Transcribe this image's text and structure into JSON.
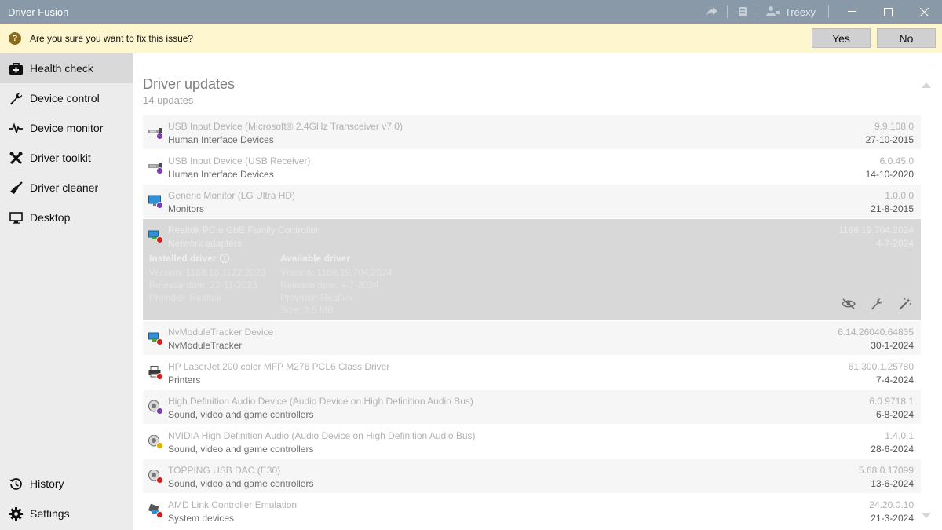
{
  "window": {
    "title": "Driver Fusion",
    "user_name": "Treexy"
  },
  "confirm": {
    "icon_glyph": "?",
    "message": "Are you sure you want to fix this issue?",
    "yes_label": "Yes",
    "no_label": "No"
  },
  "sidebar": {
    "items": [
      {
        "label": "Health check",
        "icon": "medkit-icon",
        "active": true
      },
      {
        "label": "Device control",
        "icon": "wrench-icon"
      },
      {
        "label": "Device monitor",
        "icon": "pulse-icon"
      },
      {
        "label": "Driver toolkit",
        "icon": "tools-icon"
      },
      {
        "label": "Driver cleaner",
        "icon": "broom-icon"
      },
      {
        "label": "Desktop",
        "icon": "monitor-icon"
      }
    ],
    "bottom": [
      {
        "label": "History",
        "icon": "history-icon"
      },
      {
        "label": "Settings",
        "icon": "gear-icon"
      }
    ]
  },
  "main": {
    "title": "Driver updates",
    "subtitle": "14 updates"
  },
  "devices": [
    {
      "name": "USB Input Device (Microsoft® 2.4GHz Transceiver v7.0)",
      "category": "Human Interface Devices",
      "version": "9.9.108.0",
      "date": "27-10-2015",
      "icon": "usb-icon",
      "dot": "#7b3fb0"
    },
    {
      "name": "USB Input Device (USB Receiver)",
      "category": "Human Interface Devices",
      "version": "6.0.45.0",
      "date": "14-10-2020",
      "icon": "usb-icon",
      "dot": "#7b3fb0"
    },
    {
      "name": "Generic Monitor (LG Ultra HD)",
      "category": "Monitors",
      "version": "1.0.0.0",
      "date": "21-8-2015",
      "icon": "monitor-icon",
      "dot": "#7b3fb0"
    },
    {
      "name": "Realtek PCIe GbE Family Controller",
      "category": "Network adapters",
      "version": "1168.19.704.2024",
      "date": "4-7-2024",
      "icon": "network-icon",
      "dot": "#d42020",
      "installed": {
        "heading": "Installed driver",
        "version": "Version: 1168.16.1122.2023",
        "release": "Release date: 22-11-2023",
        "provider": "Provider: Realtek"
      },
      "available": {
        "heading": "Available driver",
        "version": "Version: 1168.19.704.2024",
        "release": "Release date: 4-7-2024",
        "provider": "Provider: Realtek",
        "size": "Size: 2.5 MB"
      }
    },
    {
      "name": "NvModuleTracker Device",
      "category": "NvModuleTracker",
      "version": "6.14.26040.64835",
      "date": "30-1-2024",
      "icon": "network-icon",
      "dot": "#d42020"
    },
    {
      "name": "HP LaserJet 200 color MFP M276 PCL6 Class Driver",
      "category": "Printers",
      "version": "61.300.1.25780",
      "date": "7-4-2024",
      "icon": "printer-icon",
      "dot": "#d42020"
    },
    {
      "name": "High Definition Audio Device (Audio Device on High Definition Audio Bus)",
      "category": "Sound, video and game controllers",
      "version": "6.0.9718.1",
      "date": "6-8-2024",
      "icon": "speaker-icon",
      "dot": "#7b3fb0"
    },
    {
      "name": "NVIDIA High Definition Audio (Audio Device on High Definition Audio Bus)",
      "category": "Sound, video and game controllers",
      "version": "1.4.0.1",
      "date": "28-6-2024",
      "icon": "speaker-icon",
      "dot": "#e0b000"
    },
    {
      "name": "TOPPING USB DAC (E30)",
      "category": "Sound, video and game controllers",
      "version": "5.68.0.17099",
      "date": "13-6-2024",
      "icon": "speaker-icon",
      "dot": "#d42020"
    },
    {
      "name": "AMD Link Controller Emulation",
      "category": "System devices",
      "version": "24.20.0.10",
      "date": "21-3-2024",
      "icon": "chip-icon",
      "dot": "#d42020"
    }
  ]
}
